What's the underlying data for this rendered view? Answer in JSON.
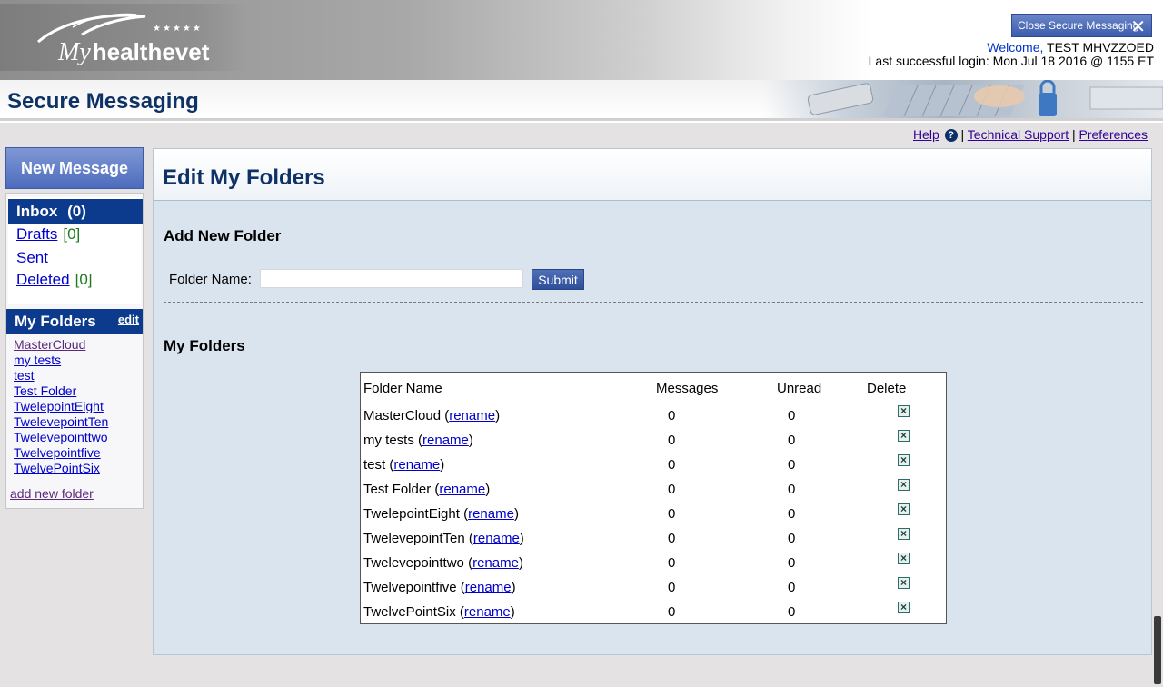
{
  "header": {
    "logo": {
      "my": "My",
      "brand": "healthevet",
      "stars": "★★★★★"
    },
    "close_button": "Close Secure Messaging",
    "welcome_label": "Welcome,",
    "user_name": "TEST MHVZZOED",
    "last_login": "Last successful login: Mon Jul 18 2016 @ 1155 ET"
  },
  "title_bar": {
    "title": "Secure Messaging"
  },
  "top_links": {
    "help": "Help",
    "technical_support": "Technical Support",
    "preferences": "Preferences",
    "separator": "|"
  },
  "sidebar": {
    "new_message": "New Message",
    "inbox": {
      "label": "Inbox",
      "count": "(0)"
    },
    "drafts": {
      "label": "Drafts",
      "count": "[0]"
    },
    "sent": {
      "label": "Sent"
    },
    "deleted": {
      "label": "Deleted",
      "count": "[0]"
    },
    "my_folders": {
      "label": "My Folders",
      "edit": "edit"
    },
    "folders": [
      "MasterCloud",
      "my tests",
      "test",
      "Test Folder",
      "TwelepointEight",
      "TwelevepointTen",
      "Twelevepointtwo",
      "Twelvepointfive",
      "TwelvePointSix"
    ],
    "add_new_folder": "add new folder"
  },
  "content": {
    "title": "Edit My Folders",
    "add_section_title": "Add New Folder",
    "folder_name_label": "Folder Name:",
    "folder_name_value": "",
    "submit": "Submit",
    "my_folders_title": "My Folders",
    "table": {
      "headers": {
        "name": "Folder Name",
        "messages": "Messages",
        "unread": "Unread",
        "delete": "Delete"
      },
      "rename_label": "rename",
      "rows": [
        {
          "name": "MasterCloud",
          "messages": "0",
          "unread": "0"
        },
        {
          "name": "my tests",
          "messages": "0",
          "unread": "0"
        },
        {
          "name": "test",
          "messages": "0",
          "unread": "0"
        },
        {
          "name": "Test Folder",
          "messages": "0",
          "unread": "0"
        },
        {
          "name": "TwelepointEight",
          "messages": "0",
          "unread": "0"
        },
        {
          "name": "TwelevepointTen",
          "messages": "0",
          "unread": "0"
        },
        {
          "name": "Twelevepointtwo",
          "messages": "0",
          "unread": "0"
        },
        {
          "name": "Twelvepointfive",
          "messages": "0",
          "unread": "0"
        },
        {
          "name": "TwelvePointSix",
          "messages": "0",
          "unread": "0"
        }
      ]
    }
  },
  "colors": {
    "nav_blue": "#0c3a8c",
    "title_blue": "#0f3266",
    "content_bg": "#dae4ee",
    "count_green": "#1e7a1e"
  },
  "icons": {
    "close": "close-x-icon",
    "help": "help-question-icon",
    "delete": "delete-x-icon"
  }
}
